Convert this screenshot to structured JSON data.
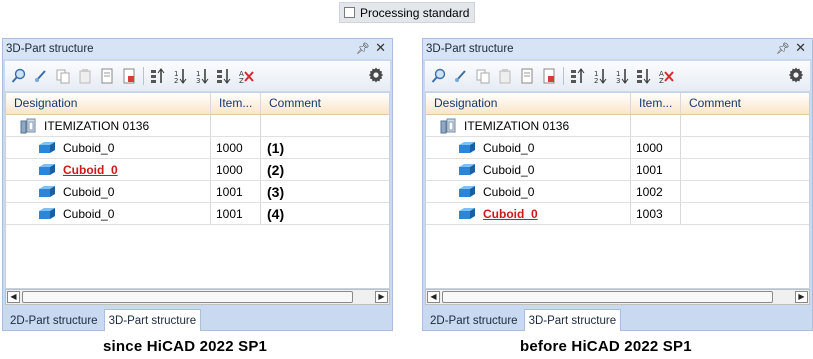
{
  "processing": {
    "label": "Processing standard",
    "checked": false
  },
  "panels": [
    {
      "title": "3D-Part structure",
      "pin_icon": "pin-icon",
      "close_icon": "close-icon",
      "columns": {
        "designation": "Designation",
        "item": "Item...",
        "comment": "Comment"
      },
      "root": {
        "label": "ITEMIZATION  0136"
      },
      "rows": [
        {
          "label": "Cuboid_0",
          "item": "1000",
          "comment": "(1)",
          "highlight": false
        },
        {
          "label": "Cuboid_0",
          "item": "1000",
          "comment": "(2)",
          "highlight": true
        },
        {
          "label": "Cuboid_0",
          "item": "1001",
          "comment": "(3)",
          "highlight": false
        },
        {
          "label": "Cuboid_0",
          "item": "1001",
          "comment": "(4)",
          "highlight": false
        }
      ],
      "tabs": [
        {
          "label": "2D-Part structure",
          "active": false
        },
        {
          "label": "3D-Part structure",
          "active": true
        }
      ]
    },
    {
      "title": "3D-Part structure",
      "pin_icon": "pin-icon",
      "close_icon": "close-icon",
      "columns": {
        "designation": "Designation",
        "item": "Item...",
        "comment": "Comment"
      },
      "root": {
        "label": "ITEMIZATION  0136"
      },
      "rows": [
        {
          "label": "Cuboid_0",
          "item": "1000",
          "comment": "",
          "highlight": false
        },
        {
          "label": "Cuboid_0",
          "item": "1001",
          "comment": "",
          "highlight": false
        },
        {
          "label": "Cuboid_0",
          "item": "1002",
          "comment": "",
          "highlight": false
        },
        {
          "label": "Cuboid_0",
          "item": "1003",
          "comment": "",
          "highlight": true
        }
      ],
      "tabs": [
        {
          "label": "2D-Part structure",
          "active": false
        },
        {
          "label": "3D-Part structure",
          "active": true
        }
      ]
    }
  ],
  "captions": {
    "left": "since HiCAD 2022 SP1",
    "right": "before HiCAD 2022 SP1"
  },
  "colors": {
    "highlight": "#d01818",
    "cuboid_icon": "#2b86d9",
    "header_bg": "#fbe5c8"
  }
}
